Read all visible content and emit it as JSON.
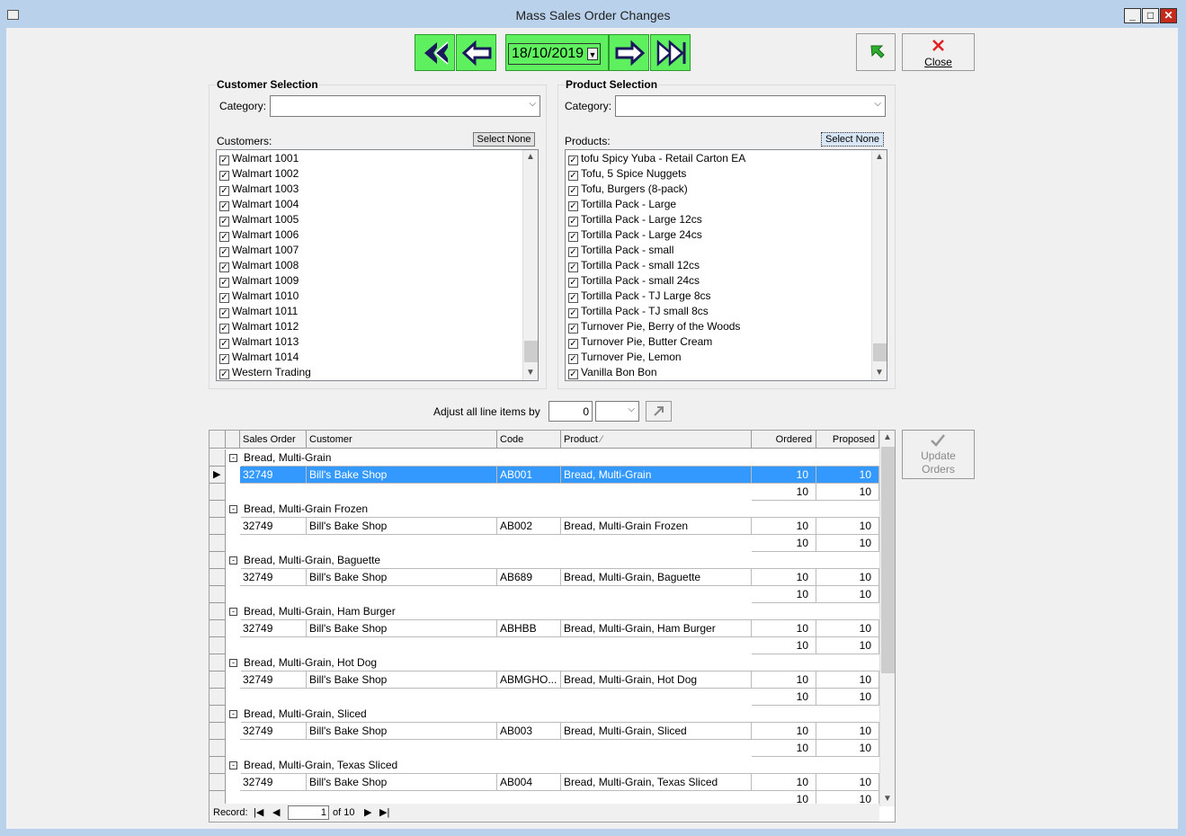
{
  "window": {
    "title": "Mass Sales Order Changes"
  },
  "nav": {
    "date": "18/10/2019"
  },
  "toolbar": {
    "close_label": "Close"
  },
  "customer": {
    "group_label": "Customer Selection",
    "category_label": "Category:",
    "category_value": "",
    "list_label": "Customers:",
    "select_none": "Select None",
    "items": [
      "Walmart 1001",
      "Walmart 1002",
      "Walmart 1003",
      "Walmart 1004",
      "Walmart 1005",
      "Walmart 1006",
      "Walmart 1007",
      "Walmart 1008",
      "Walmart 1009",
      "Walmart 1010",
      "Walmart 1011",
      "Walmart 1012",
      "Walmart 1013",
      "Walmart 1014",
      "Western Trading"
    ]
  },
  "product": {
    "group_label": "Product Selection",
    "category_label": "Category:",
    "category_value": "",
    "list_label": "Products:",
    "select_none": "Select None",
    "items": [
      "tofu Spicy Yuba - Retail Carton EA",
      "Tofu, 5 Spice Nuggets",
      "Tofu, Burgers (8-pack)",
      "Tortilla Pack - Large",
      "Tortilla Pack - Large 12cs",
      "Tortilla Pack - Large 24cs",
      "Tortilla Pack - small",
      "Tortilla Pack - small 12cs",
      "Tortilla Pack - small 24cs",
      "Tortilla Pack - TJ Large 8cs",
      "Tortilla Pack - TJ small 8cs",
      "Turnover Pie, Berry of the Woods",
      "Turnover Pie, Butter Cream",
      "Turnover Pie, Lemon",
      "Vanilla Bon Bon"
    ]
  },
  "adjust": {
    "label": "Adjust all line items by",
    "value": "0"
  },
  "update": {
    "line1": "Update",
    "line2": "Orders"
  },
  "grid": {
    "headers": {
      "sales_order": "Sales Order",
      "customer": "Customer",
      "code": "Code",
      "product": "Product",
      "product_sort": "⁄",
      "ordered": "Ordered",
      "proposed": "Proposed"
    },
    "groups": [
      {
        "name": "Bread, Multi-Grain",
        "so": "32749",
        "customer": "Bill's Bake Shop",
        "code": "AB001",
        "product": "Bread, Multi-Grain",
        "ordered": "10",
        "proposed": "10",
        "tot_ordered": "10",
        "tot_proposed": "10"
      },
      {
        "name": "Bread, Multi-Grain Frozen",
        "so": "32749",
        "customer": "Bill's Bake Shop",
        "code": "AB002",
        "product": "Bread, Multi-Grain Frozen",
        "ordered": "10",
        "proposed": "10",
        "tot_ordered": "10",
        "tot_proposed": "10"
      },
      {
        "name": "Bread, Multi-Grain, Baguette",
        "so": "32749",
        "customer": "Bill's Bake Shop",
        "code": "AB689",
        "product": "Bread, Multi-Grain, Baguette",
        "ordered": "10",
        "proposed": "10",
        "tot_ordered": "10",
        "tot_proposed": "10"
      },
      {
        "name": "Bread, Multi-Grain, Ham Burger",
        "so": "32749",
        "customer": "Bill's Bake Shop",
        "code": "ABHBB",
        "product": "Bread, Multi-Grain, Ham Burger",
        "ordered": "10",
        "proposed": "10",
        "tot_ordered": "10",
        "tot_proposed": "10"
      },
      {
        "name": "Bread, Multi-Grain, Hot Dog",
        "so": "32749",
        "customer": "Bill's Bake Shop",
        "code": "ABMGHO...",
        "product": "Bread, Multi-Grain, Hot Dog",
        "ordered": "10",
        "proposed": "10",
        "tot_ordered": "10",
        "tot_proposed": "10"
      },
      {
        "name": "Bread, Multi-Grain, Sliced",
        "so": "32749",
        "customer": "Bill's Bake Shop",
        "code": "AB003",
        "product": "Bread, Multi-Grain, Sliced",
        "ordered": "10",
        "proposed": "10",
        "tot_ordered": "10",
        "tot_proposed": "10"
      },
      {
        "name": "Bread, Multi-Grain, Texas Sliced",
        "so": "32749",
        "customer": "Bill's Bake Shop",
        "code": "AB004",
        "product": "Bread, Multi-Grain, Texas Sliced",
        "ordered": "10",
        "proposed": "10",
        "tot_ordered": "10",
        "tot_proposed": "10"
      }
    ]
  },
  "record_nav": {
    "label": "Record:",
    "current": "1",
    "of_text": "of 10"
  },
  "colors": {
    "nav_green": "#5ef05e",
    "selection": "#3399ff",
    "close_red": "#e02020",
    "arrow_green": "#2eae2e"
  }
}
